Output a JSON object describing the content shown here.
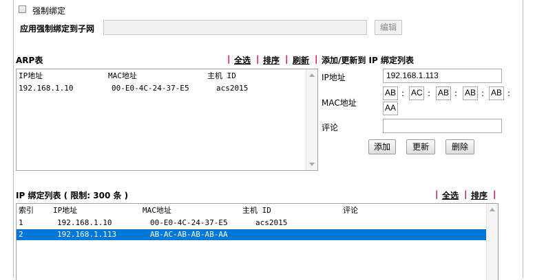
{
  "binding": {
    "checkbox_label": "强制绑定",
    "subnet_label": "应用强制绑定到子网",
    "subnet_value": "",
    "edit_button": "编辑"
  },
  "arp": {
    "title": "ARP表",
    "links": {
      "select_all": "全选",
      "sort": "排序",
      "refresh": "刷新"
    },
    "separator": "|",
    "headers": {
      "ip": "IP地址",
      "mac": "MAC地址",
      "host": "主机 ID"
    },
    "rows": [
      {
        "ip": "192.168.1.10",
        "mac": "00-E0-4C-24-37-E5",
        "host": "acs2015"
      }
    ]
  },
  "form": {
    "title": "添加/更新到 IP 绑定列表",
    "ip_label": "IP地址",
    "ip_value": "192.168.1.113",
    "mac_label": "MAC地址",
    "mac_parts": [
      "AB",
      "AC",
      "AB",
      "AB",
      "AB",
      "AA"
    ],
    "mac_sep": ":",
    "comment_label": "评论",
    "comment_value": "",
    "buttons": {
      "add": "添加",
      "update": "更新",
      "delete": "删除"
    }
  },
  "binding_list": {
    "title": "IP 绑定列表 ( 限制: 300 条 )",
    "links": {
      "select_all": "全选",
      "sort": "排序"
    },
    "headers": {
      "index": "索引",
      "ip": "IP地址",
      "mac": "MAC地址",
      "host": "主机 ID",
      "comment": "评论"
    },
    "rows": [
      {
        "index": "1",
        "ip": "192.168.1.10",
        "mac": "00-E0-4C-24-37-E5",
        "host": "acs2015",
        "comment": "",
        "selected": false
      },
      {
        "index": "2",
        "ip": "192.168.1.113",
        "mac": "AB-AC-AB-AB-AB-AA",
        "host": "",
        "comment": "",
        "selected": true
      }
    ]
  },
  "colors": {
    "separator": "#d0001e",
    "selection": "#0078d7"
  }
}
